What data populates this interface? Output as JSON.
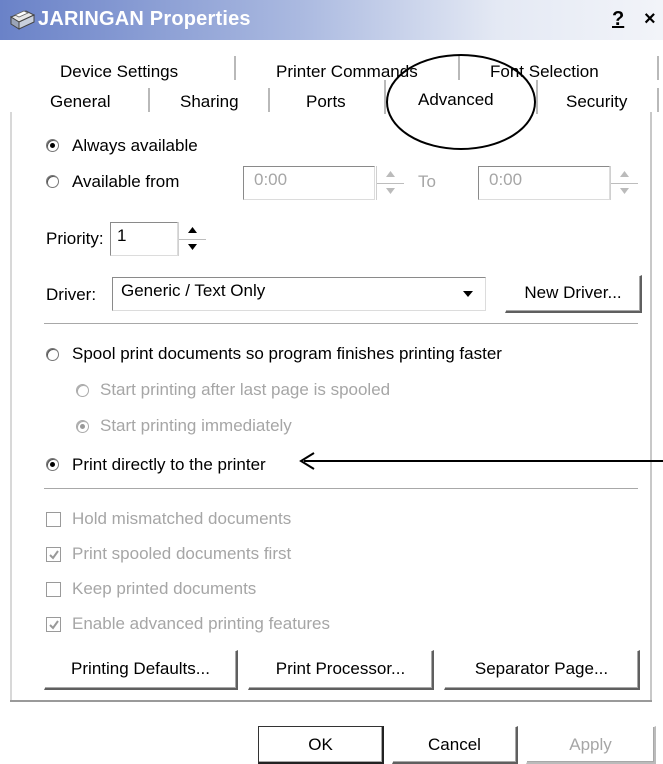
{
  "window": {
    "title": "JARINGAN Properties",
    "help_label": "?",
    "close_label": "×"
  },
  "tabs": {
    "row1": [
      "Device Settings",
      "Printer Commands",
      "Font Selection"
    ],
    "row2": [
      "General",
      "Sharing",
      "Ports",
      "Advanced",
      "Security"
    ],
    "active": "Advanced"
  },
  "availability": {
    "always_label": "Always available",
    "from_label": "Available from",
    "from_value": "0:00",
    "to_label": "To",
    "to_value": "0:00",
    "selected": "always"
  },
  "priority": {
    "label": "Priority:",
    "value": "1"
  },
  "driver": {
    "label": "Driver:",
    "selected": "Generic / Text Only",
    "new_driver_button": "New Driver..."
  },
  "spooling": {
    "spool_label": "Spool print documents so program finishes printing faster",
    "start_after_last_label": "Start printing after last page is spooled",
    "start_immediately_label": "Start printing immediately",
    "direct_label": "Print directly to the printer",
    "selected": "direct"
  },
  "options": {
    "hold_mismatched": {
      "label": "Hold mismatched documents",
      "checked": false
    },
    "print_spooled_first": {
      "label": "Print spooled documents first",
      "checked": true
    },
    "keep_printed": {
      "label": "Keep printed documents",
      "checked": false
    },
    "enable_advanced": {
      "label": "Enable advanced printing features",
      "checked": true
    }
  },
  "panel_buttons": {
    "printing_defaults": "Printing Defaults...",
    "print_processor": "Print Processor...",
    "separator_page": "Separator Page..."
  },
  "dialog_buttons": {
    "ok": "OK",
    "cancel": "Cancel",
    "apply": "Apply"
  },
  "annotation": {
    "ellipse_color": "#000000",
    "arrow_color": "#000000"
  }
}
